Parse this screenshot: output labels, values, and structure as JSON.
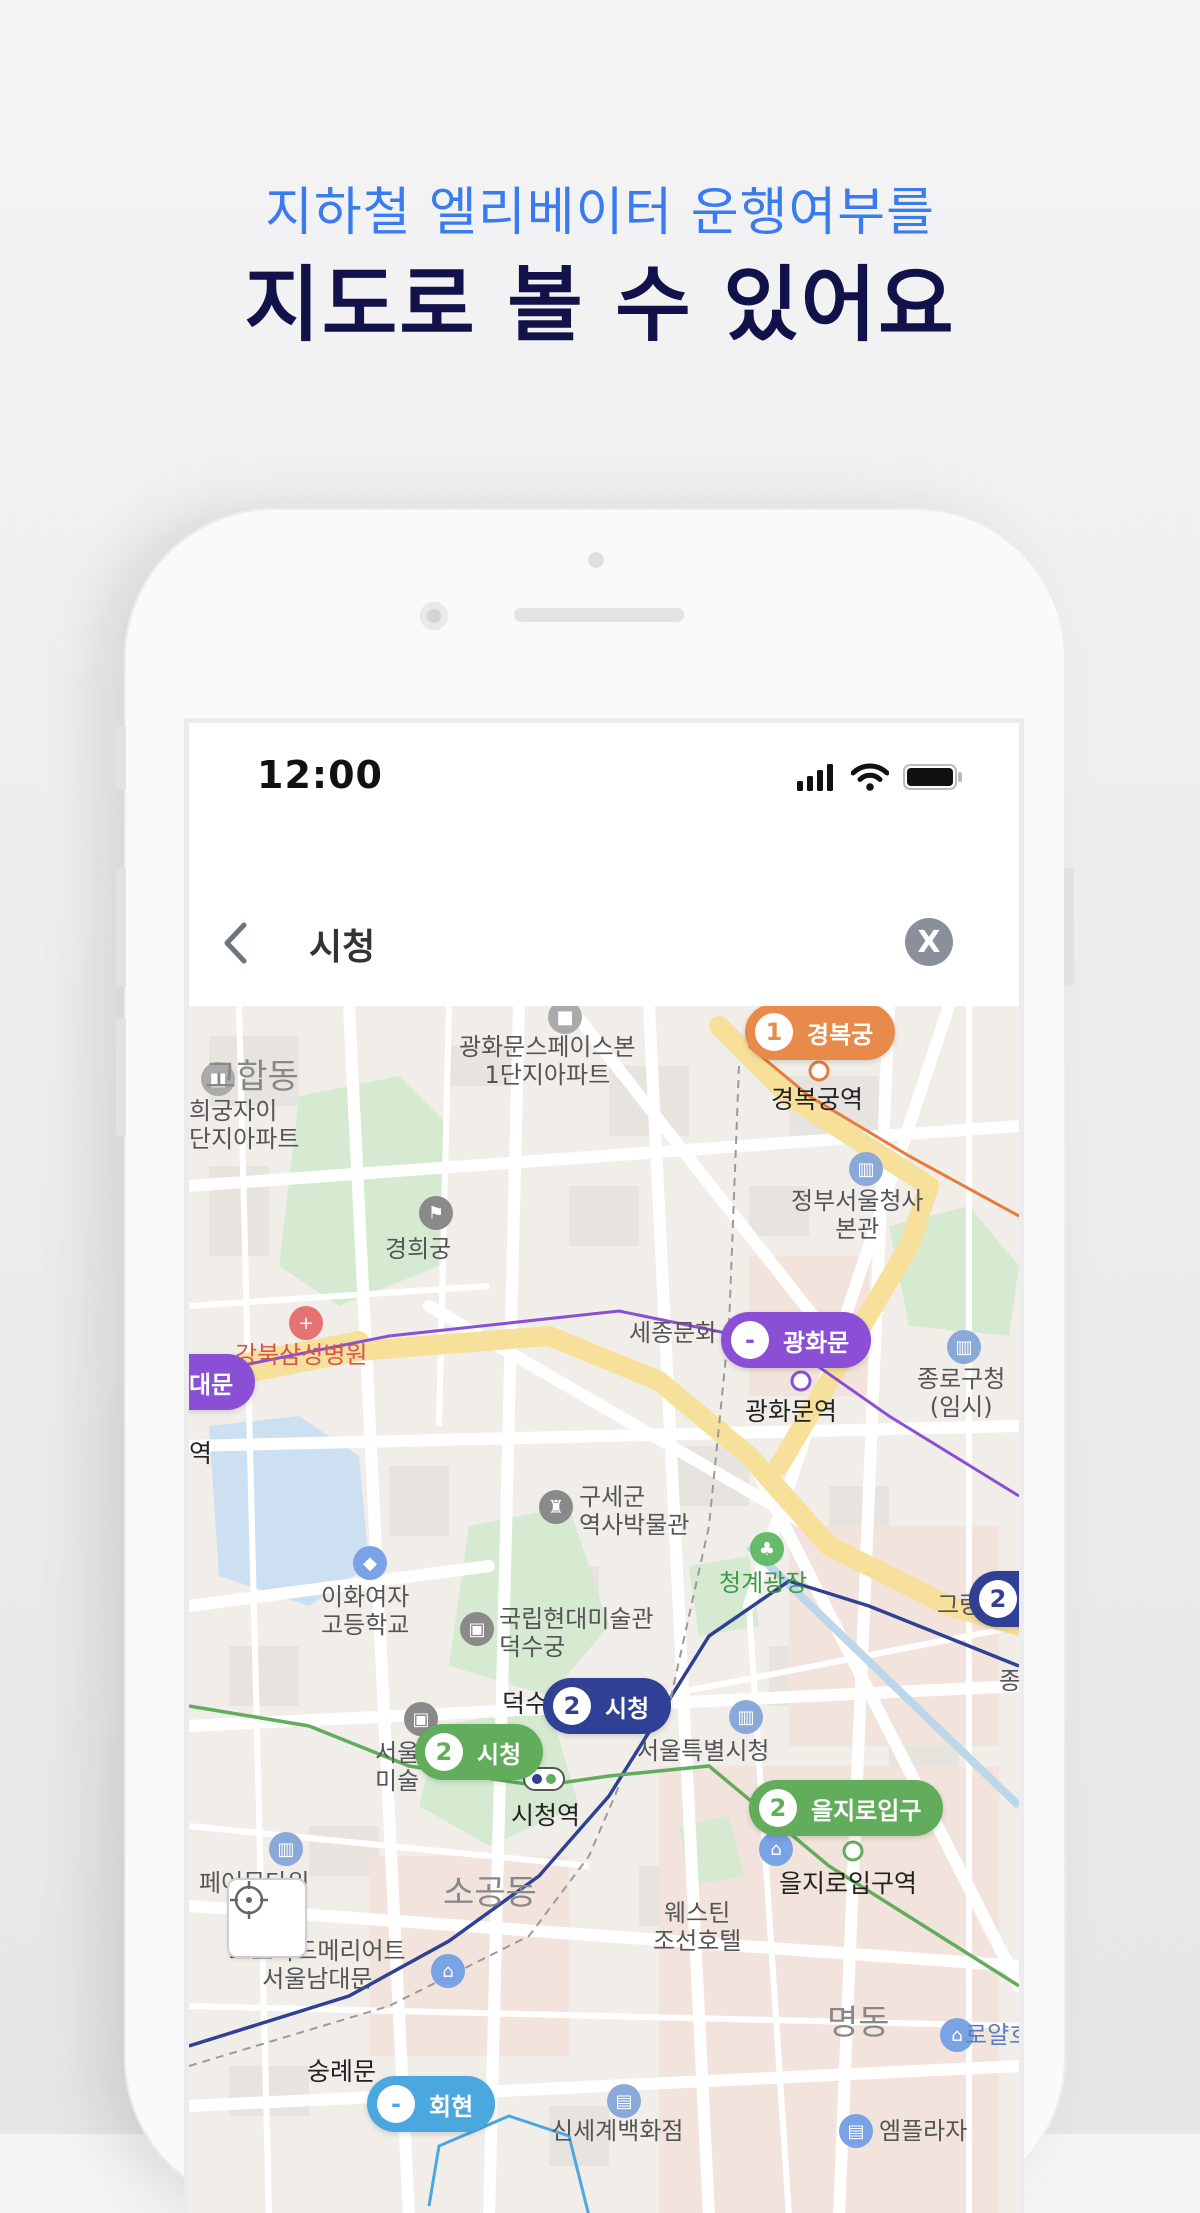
{
  "headline": {
    "line1": "지하철 엘리베이터 운행여부를",
    "line2": "지도로 볼 수 있어요"
  },
  "status_bar": {
    "time": "12:00",
    "icons": [
      "signal-icon",
      "wifi-icon",
      "battery-icon"
    ]
  },
  "search": {
    "query": "시청",
    "back_icon": "chevron-left-icon",
    "clear_label": "X"
  },
  "colors": {
    "headline_sub": "#3a7cf0",
    "headline_main": "#12124a",
    "line1_orange": "#e88a4a",
    "line2_navy": "#2f4095",
    "line2_green": "#62ad5c",
    "line5_purple": "#8a4fd4",
    "line4_skyblue": "#4aa8de"
  },
  "stations": [
    {
      "num": "1",
      "name": "경복궁",
      "color": "#e88a4a"
    },
    {
      "num": "-",
      "name": "광화문",
      "color": "#8a4fd4"
    },
    {
      "num": "2",
      "name": "시청",
      "color": "#2f4095"
    },
    {
      "num": "2",
      "name": "시청",
      "color": "#62ad5c"
    },
    {
      "num": "2",
      "name": "을지로입구",
      "color": "#62ad5c"
    },
    {
      "num": "-",
      "name": "회현",
      "color": "#4aa8de"
    },
    {
      "num": "2",
      "name": "",
      "color": "#2f4095"
    },
    {
      "num": "",
      "name": "대문",
      "color": "#8a4fd4"
    }
  ],
  "map_labels": {
    "a": "광화문스페이스본\n1단지아파트",
    "b": "경복궁역",
    "c": "고합동",
    "d": "희궁자이\n단지아파트",
    "e": "정부서울청사\n본관",
    "f": "경희궁",
    "g": "강북삼성병원",
    "h": "세종문화",
    "i": "광화문역",
    "j": "종로구청\n(임시)",
    "k": "역",
    "l": "구세군\n역사박물관",
    "m": "청계광장",
    "n": "이화여자\n고등학교",
    "o": "국립현대미술관\n덕수궁",
    "p": "그랑",
    "q": "종",
    "r": "덕수",
    "s": "서울특별시청",
    "t": "서울\n미술",
    "u": "시청역",
    "v": "을지로입구역",
    "w": "웨스틴\n조선호텔",
    "x": "소공동",
    "y": "페어몬타워",
    "z": "코트야드메리어트\n서울남대문",
    "aa": "명동",
    "ab": "로얄호",
    "ac": "숭례문",
    "ad": "신세계백화점",
    "ae": "엠플라자"
  }
}
